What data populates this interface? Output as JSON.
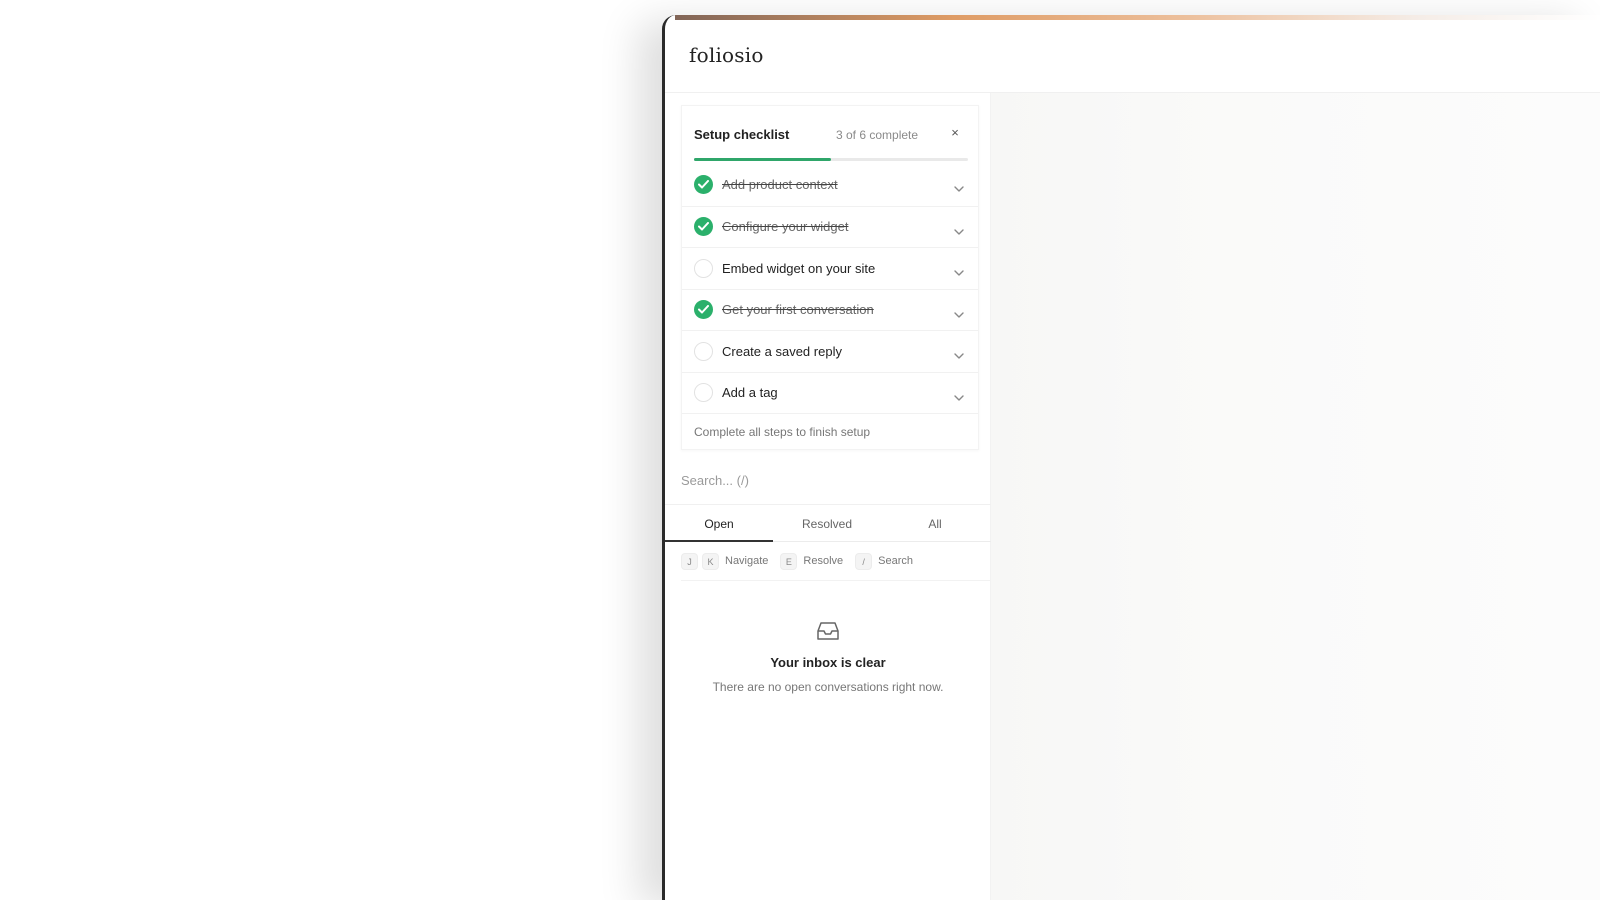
{
  "app": {
    "logo": "foliosio"
  },
  "colors": {
    "accent": "#2fa66a",
    "check_done": "#2bb06b",
    "text": "#222222",
    "muted": "#8a8a8a"
  },
  "checklist": {
    "title": "Setup checklist",
    "progress_text": "3 of 6 complete",
    "progress_fraction": 0.5,
    "close_icon": "×",
    "items": [
      {
        "label": "Add product context",
        "done": true
      },
      {
        "label": "Configure your widget",
        "done": true
      },
      {
        "label": "Embed widget on your site",
        "done": false
      },
      {
        "label": "Get your first conversation",
        "done": true
      },
      {
        "label": "Create a saved reply",
        "done": false
      },
      {
        "label": "Add a tag",
        "done": false
      }
    ],
    "footer": "Complete all steps to finish setup"
  },
  "search": {
    "placeholder": "Search... (/)"
  },
  "tabs": [
    {
      "label": "Open",
      "active": true
    },
    {
      "label": "Resolved",
      "active": false
    },
    {
      "label": "All",
      "active": false
    }
  ],
  "shortcuts": [
    {
      "keys": [
        "J",
        "K"
      ],
      "label": "Navigate"
    },
    {
      "keys": [
        "E"
      ],
      "label": "Resolve"
    },
    {
      "keys": [
        "/"
      ],
      "label": "Search"
    }
  ],
  "empty_state": {
    "icon": "inbox-icon",
    "title": "Your inbox is clear",
    "subtitle": "There are no open conversations right now."
  }
}
